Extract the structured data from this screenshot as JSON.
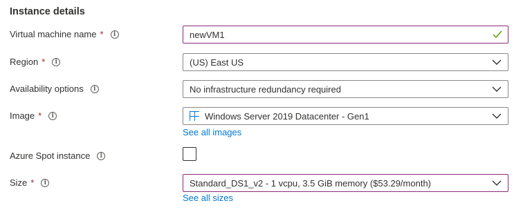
{
  "section": {
    "title": "Instance details"
  },
  "vm_name": {
    "label": "Virtual machine name",
    "required": "*",
    "value": "newVM1"
  },
  "region": {
    "label": "Region",
    "required": "*",
    "value": "(US) East US"
  },
  "availability": {
    "label": "Availability options",
    "value": "No infrastructure redundancy required"
  },
  "image": {
    "label": "Image",
    "required": "*",
    "value": "Windows Server 2019 Datacenter - Gen1",
    "link": "See all images"
  },
  "spot": {
    "label": "Azure Spot instance",
    "checked": false
  },
  "size": {
    "label": "Size",
    "required": "*",
    "value": "Standard_DS1_v2 - 1 vcpu, 3.5 GiB memory ($53.29/month)",
    "link": "See all sizes"
  },
  "icons": {
    "info": "info-icon",
    "chevron": "chevron-down-icon",
    "check": "checkmark-icon",
    "windows": "windows-logo-icon"
  },
  "colors": {
    "accent": "#8a2a7a",
    "link": "#0078d4",
    "required": "#a4262c",
    "valid": "#57a300"
  }
}
